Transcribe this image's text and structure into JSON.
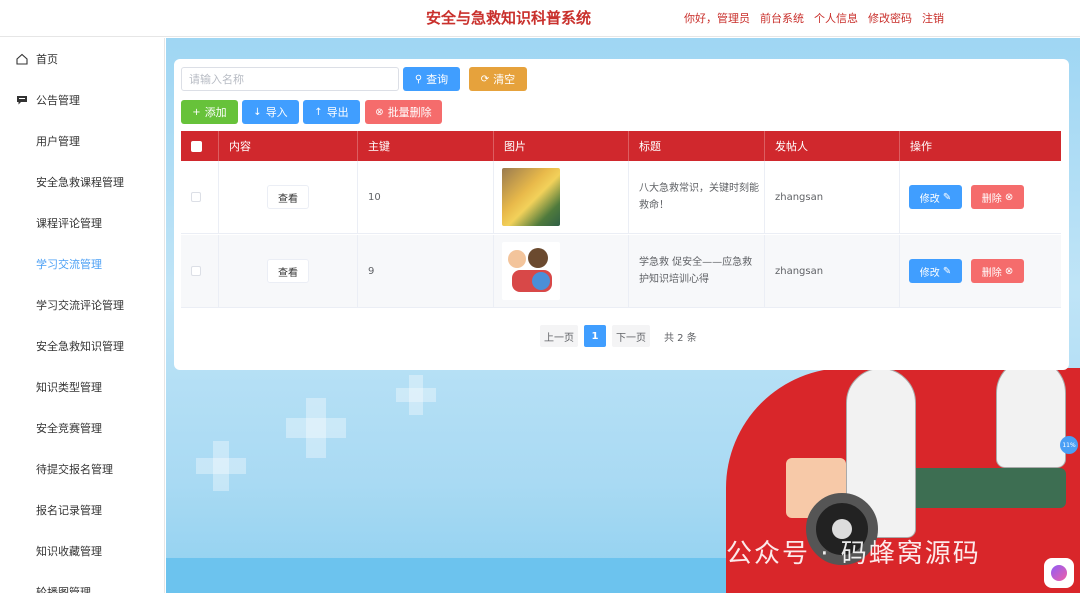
{
  "header": {
    "title": "安全与急救知识科普系统",
    "nav": [
      "你好，管理员",
      "前台系统",
      "个人信息",
      "修改密码",
      "注销"
    ]
  },
  "sidebar": {
    "items": [
      {
        "label": "首页",
        "icon": "home-icon"
      },
      {
        "label": "公告管理",
        "icon": "message-icon"
      },
      {
        "label": "用户管理",
        "icon": "grid-icon"
      },
      {
        "label": "安全急救课程管理",
        "icon": "grid-icon"
      },
      {
        "label": "课程评论管理",
        "icon": "grid-icon"
      },
      {
        "label": "学习交流管理",
        "icon": "grid-icon",
        "active": true
      },
      {
        "label": "学习交流评论管理",
        "icon": "grid-icon"
      },
      {
        "label": "安全急救知识管理",
        "icon": "grid-icon"
      },
      {
        "label": "知识类型管理",
        "icon": "grid-icon"
      },
      {
        "label": "安全竞赛管理",
        "icon": "grid-icon"
      },
      {
        "label": "待提交报名管理",
        "icon": "grid-icon"
      },
      {
        "label": "报名记录管理",
        "icon": "grid-icon"
      },
      {
        "label": "知识收藏管理",
        "icon": "grid-icon"
      },
      {
        "label": "轮播图管理",
        "icon": "grid-icon"
      }
    ]
  },
  "search": {
    "placeholder": "请输入名称",
    "query_label": "查询",
    "clear_label": "清空"
  },
  "toolbar": {
    "add_label": "添加",
    "import_label": "导入",
    "export_label": "导出",
    "bulk_delete_label": "批量删除"
  },
  "table": {
    "headers": [
      "内容",
      "主键",
      "图片",
      "标题",
      "发帖人",
      "操作"
    ],
    "rows": [
      {
        "content_btn": "查看",
        "id": "10",
        "title": "八大急救常识，关键时刻能救命！",
        "poster": "zhangsan",
        "edit": "修改",
        "delete": "删除"
      },
      {
        "content_btn": "查看",
        "id": "9",
        "title": "学急救 促安全——应急救护知识培训心得",
        "poster": "zhangsan",
        "edit": "修改",
        "delete": "删除"
      }
    ]
  },
  "pagination": {
    "prev": "上一页",
    "current": "1",
    "next": "下一页",
    "total": "共 2 条"
  },
  "overlay": {
    "watermark": "公众号 · 码蜂窝源码",
    "badge": "11%"
  },
  "colors": {
    "brand_red": "#d0282d",
    "primary": "#409eff",
    "warning": "#e6a23c",
    "success": "#67c23a",
    "danger": "#f56c6c",
    "active_menu": "#4a9ff5"
  }
}
